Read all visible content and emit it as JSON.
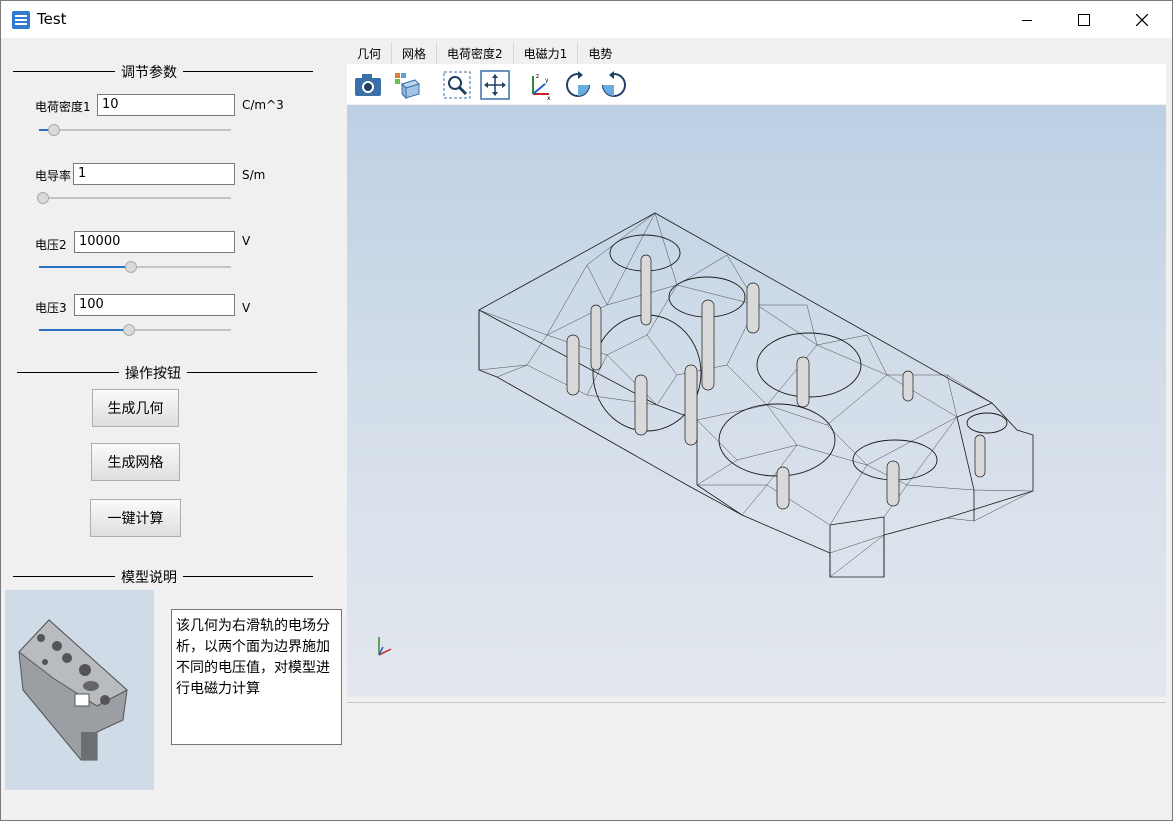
{
  "window": {
    "title": "Test"
  },
  "left_panel": {
    "params_title": "调节参数",
    "params": [
      {
        "label": "电荷密度1",
        "value": "10",
        "unit": "C/m^3",
        "slider": 0.08
      },
      {
        "label": "电导率",
        "value": "1",
        "unit": "S/m",
        "slider": 0.0
      },
      {
        "label": "电压2",
        "value": "10000",
        "unit": "V",
        "slider": 0.48
      },
      {
        "label": "电压3",
        "value": "100",
        "unit": "V",
        "slider": 0.47
      }
    ],
    "ops_title": "操作按钮",
    "buttons": {
      "geometry": "生成几何",
      "mesh": "生成网格",
      "compute": "一键计算"
    },
    "model_title": "模型说明",
    "model_description": "该几何为右滑轨的电场分析，以两个面为边界施加不同的电压值，对模型进行电磁力计算"
  },
  "tabs": [
    "几何",
    "网格",
    "电荷密度2",
    "电磁力1",
    "电势"
  ],
  "toolbar": [
    "camera-icon",
    "view-cube-icon",
    "zoom-box-icon",
    "fit-all-icon",
    "axes-icon",
    "rotate-ccw-icon",
    "rotate-cw-icon"
  ],
  "colors": {
    "accent": "#2a72c3",
    "viewport_top": "#bdd0e4",
    "viewport_bottom": "#e3e7ee"
  }
}
